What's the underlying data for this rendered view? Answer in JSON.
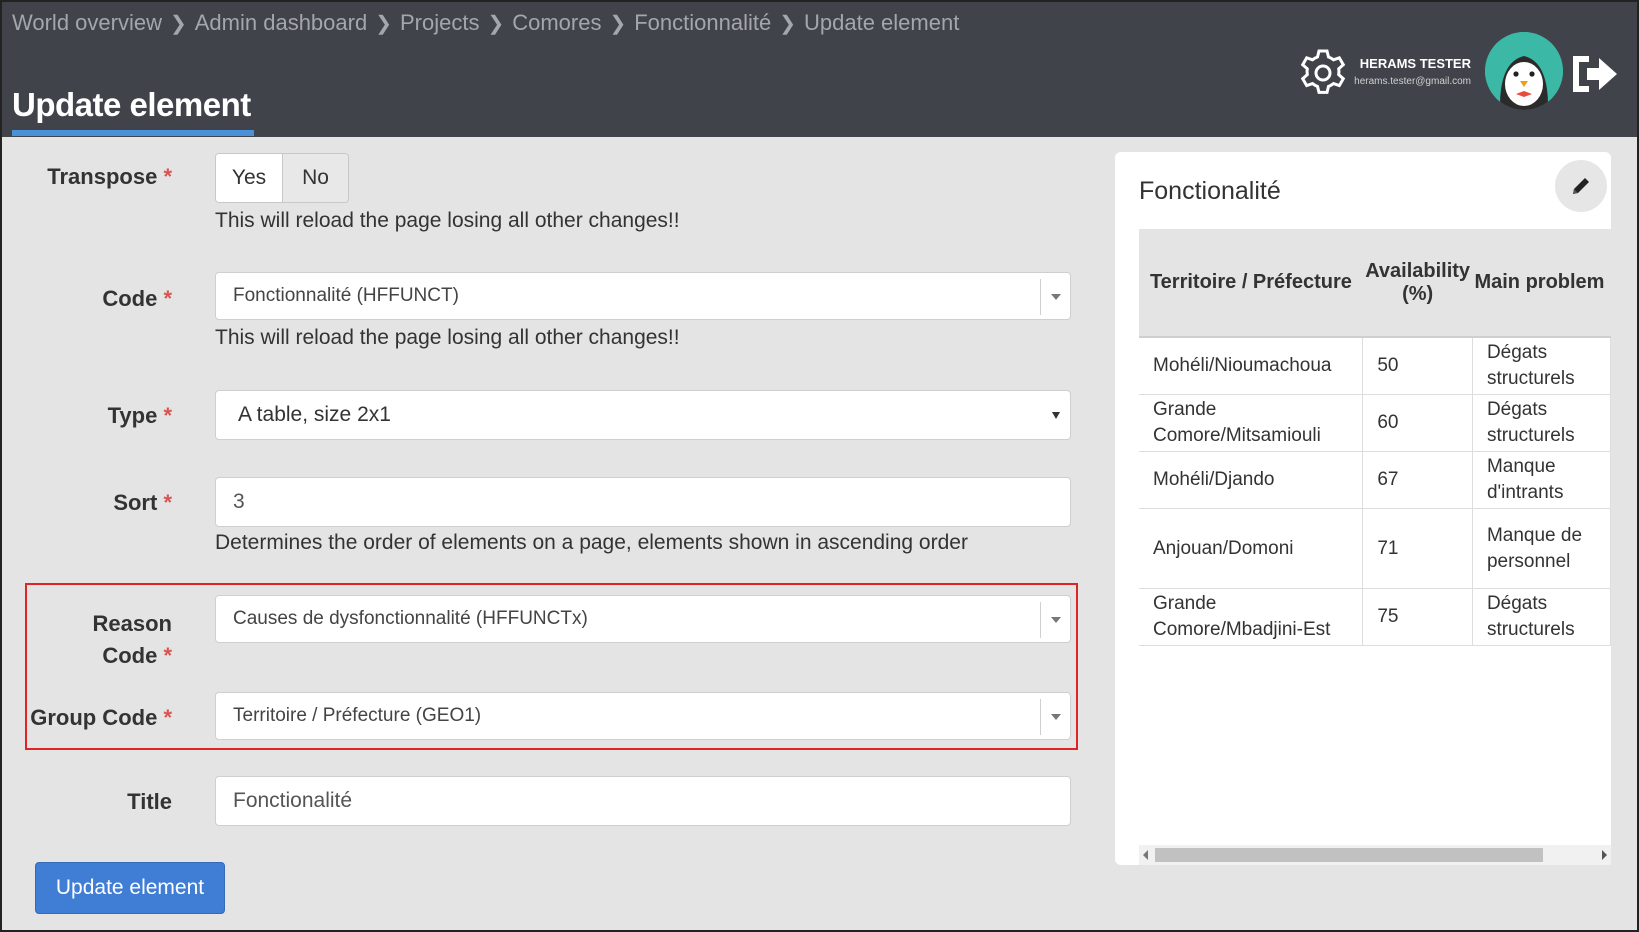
{
  "breadcrumb": [
    "World overview",
    "Admin dashboard",
    "Projects",
    "Comores",
    "Fonctionnalité",
    "Update element"
  ],
  "header": {
    "title": "Update element",
    "user_name": "HERAMS TESTER",
    "user_email": "herams.tester@gmail.com"
  },
  "form": {
    "transpose": {
      "label": "Transpose",
      "required": "*",
      "options": [
        "Yes",
        "No"
      ],
      "selected": "No",
      "help": "This will reload the page losing all other changes!!"
    },
    "code": {
      "label": "Code",
      "required": "*",
      "value": "Fonctionnalité (HFFUNCT)",
      "help": "This will reload the page losing all other changes!!"
    },
    "type": {
      "label": "Type",
      "required": "*",
      "value": "A table, size 2x1"
    },
    "sort": {
      "label": "Sort",
      "required": "*",
      "value": "3",
      "help": "Determines the order of elements on a page, elements shown in ascending order"
    },
    "reason_code": {
      "label_line1": "Reason",
      "label_line2": "Code",
      "required": "*",
      "value": "Causes de dysfonctionnalité (HFFUNCTx)"
    },
    "group_code": {
      "label": "Group Code",
      "required": "*",
      "value": "Territoire / Préfecture (GEO1)"
    },
    "title": {
      "label": "Title",
      "value": "Fonctionalité"
    },
    "submit_label": "Update element"
  },
  "preview": {
    "title": "Fonctionalité",
    "columns": [
      "Territoire / Préfecture",
      "Availability (%)",
      "Main problem"
    ],
    "rows": [
      [
        "Mohéli/Nioumachoua",
        "50",
        "Dégats structurels"
      ],
      [
        "Grande Comore/Mitsamiouli",
        "60",
        "Dégats structurels"
      ],
      [
        "Mohéli/Djando",
        "67",
        "Manque d'intrants"
      ],
      [
        "Anjouan/Domoni",
        "71",
        "Manque de personnel"
      ],
      [
        "Grande Comore/Mbadjini-Est",
        "75",
        "Dégats structurels"
      ]
    ]
  },
  "colors": {
    "header_bg": "#40434a",
    "accent": "#4a90d9",
    "primary_button": "#3f7ed4",
    "highlight_border": "#e02424",
    "required": "#d9534f"
  },
  "icons": [
    "gear-icon",
    "avatar",
    "logout-icon",
    "pencil-icon",
    "chevron-right-icon",
    "chevron-down-icon"
  ]
}
